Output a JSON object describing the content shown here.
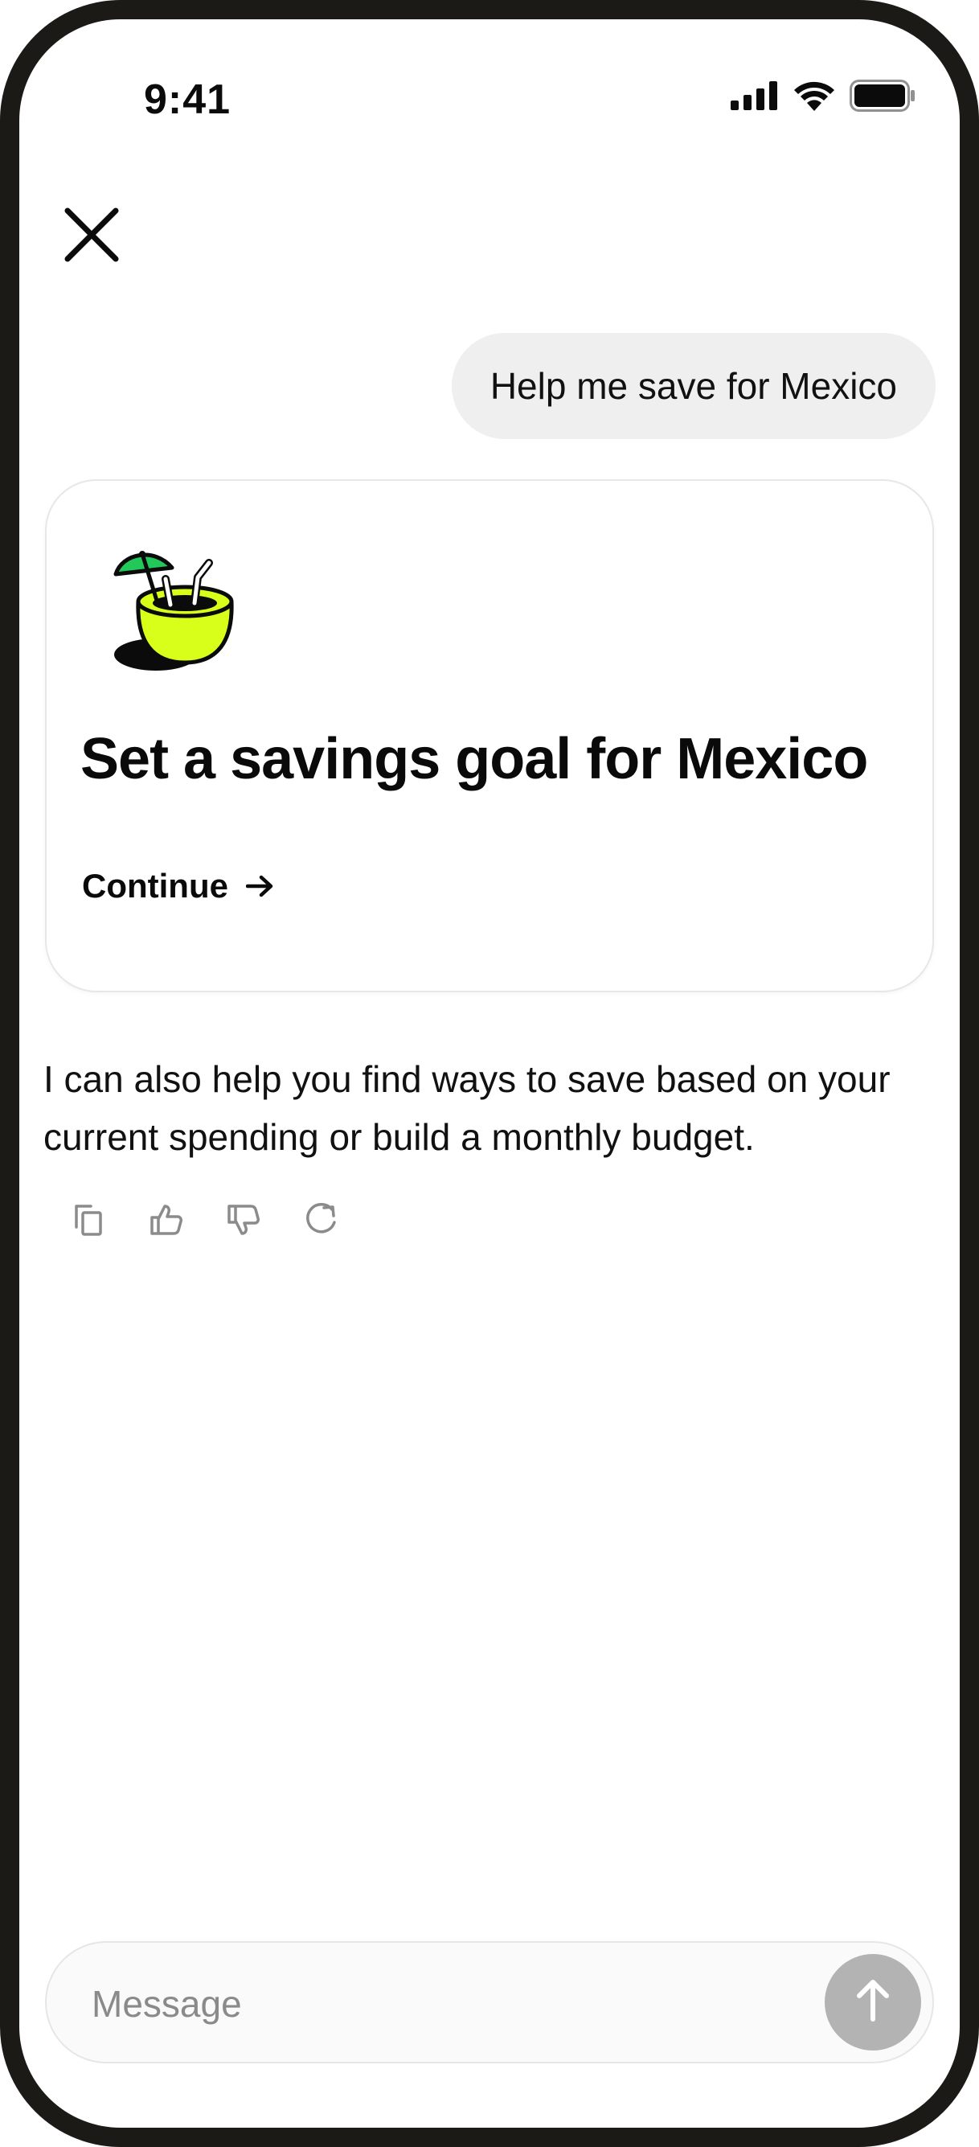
{
  "status_bar": {
    "time": "9:41",
    "icons": [
      "signal-icon",
      "wifi-icon",
      "battery-icon"
    ]
  },
  "header": {
    "close_icon": "close-icon"
  },
  "conversation": {
    "user_message": "Help me save for Mexico",
    "card": {
      "illustration": "coconut-drink-illustration",
      "title": "Set a savings goal for Mexico",
      "cta_label": "Continue",
      "cta_icon": "arrow-right-icon"
    },
    "assistant_message": "I can also help you find ways to save based on your current spending or build a monthly budget.",
    "actions": [
      "copy-icon",
      "thumbs-up-icon",
      "thumbs-down-icon",
      "regenerate-icon"
    ]
  },
  "composer": {
    "placeholder": "Message",
    "value": "",
    "send_icon": "arrow-up-icon"
  },
  "colors": {
    "frame": "#1b1a17",
    "bubble": "#efefef",
    "accent_lime": "#d8ff1a",
    "accent_green": "#23c85a",
    "send_button": "#b3b3b3"
  }
}
